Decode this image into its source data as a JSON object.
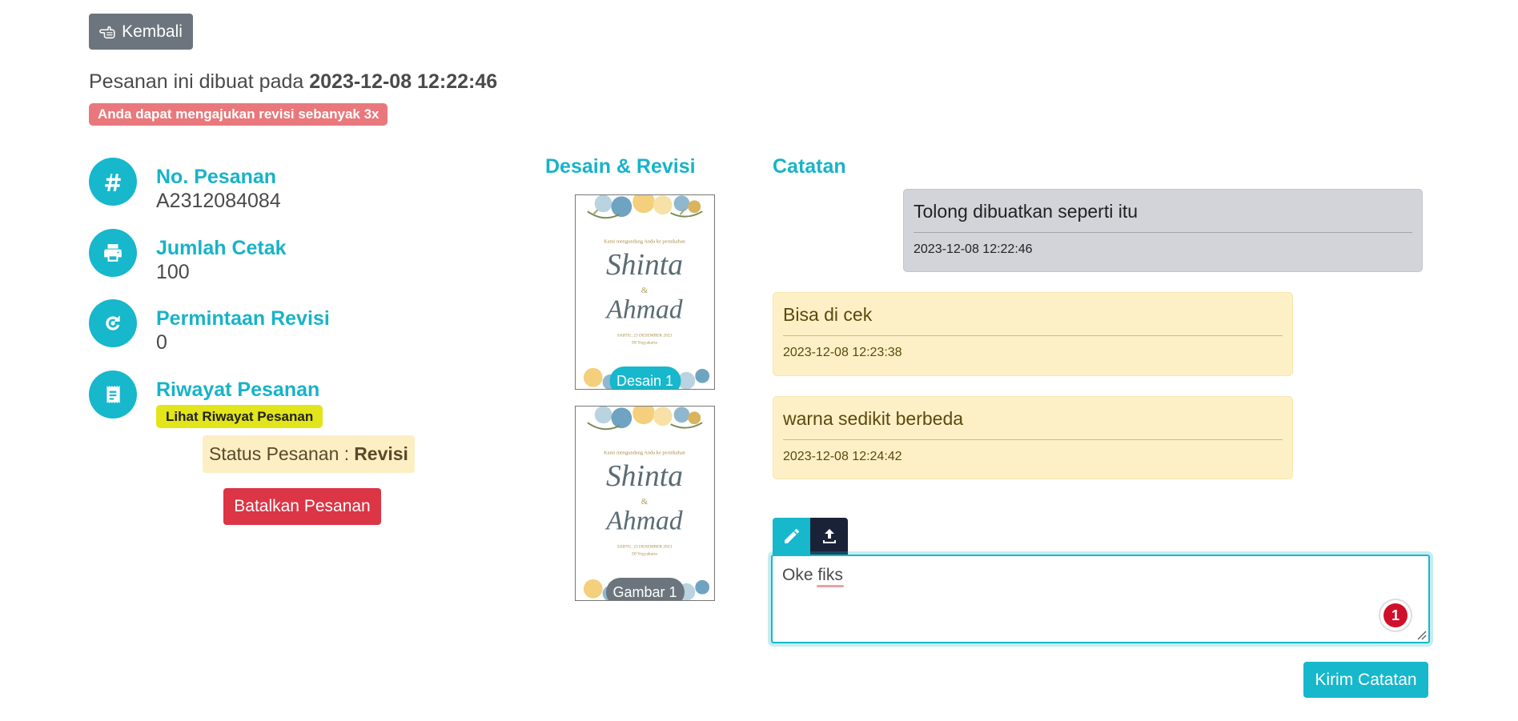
{
  "back_button": {
    "label": "Kembali",
    "icon": "hand-pointing-left-icon"
  },
  "order_created": {
    "prefix": "Pesanan ini dibuat pada",
    "datetime": "2023-12-08 12:22:46"
  },
  "revision_notice": "Anda dapat mengajukan revisi sebanyak 3x",
  "info": {
    "order_number": {
      "label": "No. Pesanan",
      "value": "A2312084084",
      "icon": "hashtag-icon"
    },
    "print_count": {
      "label": "Jumlah Cetak",
      "value": "100",
      "icon": "printer-icon"
    },
    "revision_requests": {
      "label": "Permintaan Revisi",
      "value": "0",
      "icon": "revision-icon"
    },
    "history": {
      "label": "Riwayat Pesanan",
      "button": "Lihat Riwayat Pesanan",
      "icon": "receipt-icon"
    }
  },
  "status": {
    "label": "Status Pesanan :",
    "value": "Revisi"
  },
  "cancel_button": "Batalkan Pesanan",
  "design_section": {
    "title": "Desain & Revisi",
    "items": [
      {
        "pill": "Desain 1"
      },
      {
        "pill": "Gambar 1"
      }
    ],
    "card": {
      "invite": "Kami mengundang Anda ke pernikahan",
      "bride": "Shinta",
      "amp": "&",
      "groom": "Ahmad",
      "date": "SABTU, 23 DESEMBER 2023",
      "place": "DI Yogyakarta"
    }
  },
  "notes_section": {
    "title": "Catatan",
    "notes": [
      {
        "text": "Tolong dibuatkan seperti itu",
        "time": "2023-12-08 12:22:46",
        "variant": "gray"
      },
      {
        "text": "Bisa di cek",
        "time": "2023-12-08 12:23:38",
        "variant": "yellow"
      },
      {
        "text": "warna sedikit berbeda",
        "time": "2023-12-08 12:24:42",
        "variant": "yellow"
      }
    ],
    "input_value": "Oke fiks",
    "grammar_badge_count": "1",
    "send_button": "Kirim Catatan",
    "tools": {
      "edit_icon": "pencil-icon",
      "upload_icon": "upload-icon"
    }
  },
  "colors": {
    "accent": "#17b7cc",
    "danger": "#dc3545",
    "secondary": "#6c757d",
    "warning_bg": "#fdf0c6",
    "yellow_badge": "#e2e519"
  }
}
